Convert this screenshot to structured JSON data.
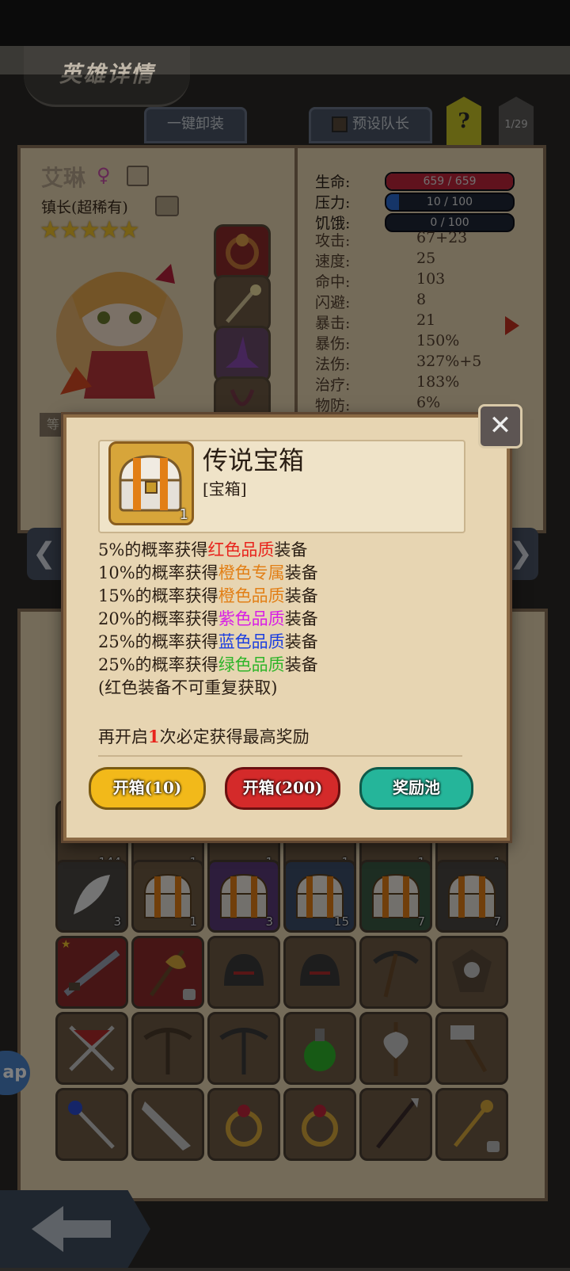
{
  "header": {
    "title": "英雄详情",
    "unequip_all": "一键卸装",
    "preset_leader": "预设队长",
    "help": "?",
    "page_counter": "1/29"
  },
  "hero": {
    "name": "艾琳",
    "title": "镇长(超稀有)",
    "stars": "★★★★★",
    "level_label": "等"
  },
  "stats": {
    "hp_label": "生命:",
    "hp_value": "659 / 659",
    "hp_fraction": 1.0,
    "stress_label": "压力:",
    "stress_value": "10 / 100",
    "stress_fraction": 0.1,
    "hunger_label": "饥饿:",
    "hunger_value": "0 / 100",
    "hunger_fraction": 0.0,
    "rows": [
      {
        "label": "攻击:",
        "value": "67+23"
      },
      {
        "label": "速度:",
        "value": "25"
      },
      {
        "label": "命中:",
        "value": "103"
      },
      {
        "label": "闪避:",
        "value": "8"
      },
      {
        "label": "暴击:",
        "value": "21"
      },
      {
        "label": "暴伤:",
        "value": "150%"
      },
      {
        "label": "法伤:",
        "value": "327%+5"
      },
      {
        "label": "治疗:",
        "value": "183%"
      },
      {
        "label": "物防:",
        "value": "6%"
      }
    ]
  },
  "modal": {
    "item_name": "传说宝箱",
    "item_type": "[宝箱]",
    "item_count": "1",
    "lines": [
      {
        "pct": "5%的概率获得",
        "hl": "红色品质",
        "tail": "装备",
        "color": "#e8231c"
      },
      {
        "pct": "10%的概率获得",
        "hl": "橙色专属",
        "tail": "装备",
        "color": "#e27f16"
      },
      {
        "pct": "15%的概率获得",
        "hl": "橙色品质",
        "tail": "装备",
        "color": "#e27f16"
      },
      {
        "pct": "20%的概率获得",
        "hl": "紫色品质",
        "tail": "装备",
        "color": "#d81ee6"
      },
      {
        "pct": "25%的概率获得",
        "hl": "蓝色品质",
        "tail": "装备",
        "color": "#1d3fe0"
      },
      {
        "pct": "25%的概率获得",
        "hl": "绿色品质",
        "tail": "装备",
        "color": "#2fb52a"
      }
    ],
    "note": "(红色装备不可重复获取)",
    "pity_pre": "再开启",
    "pity_num": "1",
    "pity_post": "次必定获得最高奖励",
    "btn_open10": "开箱(10)",
    "btn_open200": "开箱(200)",
    "btn_pool": "奖励池"
  },
  "inventory": {
    "row0_counts": [
      "144",
      "1",
      "1",
      "1",
      "1",
      "1"
    ],
    "row1": [
      {
        "count": "3",
        "color": "#4a4643"
      },
      {
        "count": "1",
        "color": "#6f5a43"
      },
      {
        "count": "3",
        "color": "#5a3a78"
      },
      {
        "count": "15",
        "color": "#3d4e6a"
      },
      {
        "count": "7",
        "color": "#3b5a44"
      },
      {
        "count": "7",
        "color": "#4a4643"
      }
    ]
  },
  "side_pill": "ap",
  "colors": {
    "hp_bar": "#c0243a",
    "stress_bar": "#2a6ad0",
    "btn_yellow": "#f2b91a",
    "btn_red": "#d42a2a",
    "btn_teal": "#25b59a"
  }
}
